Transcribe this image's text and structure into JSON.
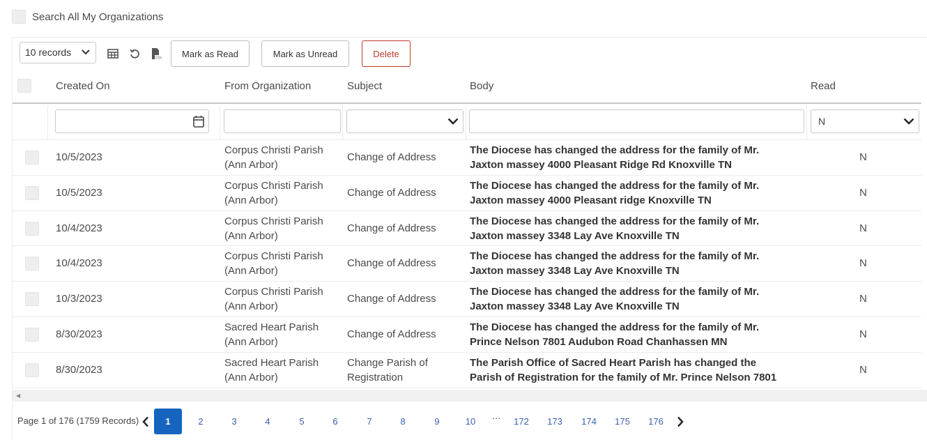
{
  "search_all": {
    "label": "Search All My Organizations"
  },
  "toolbar": {
    "records_value": "10 records",
    "grid_icon": "table-icon",
    "reset_icon": "refresh-icon",
    "csv_icon": "csv-export-icon",
    "mark_read_label": "Mark as Read",
    "mark_unread_label": "Mark as Unread",
    "delete_label": "Delete"
  },
  "columns": {
    "created_on": "Created On",
    "from_org": "From Organization",
    "subject": "Subject",
    "body": "Body",
    "read": "Read"
  },
  "filters": {
    "created_on": "",
    "from_org": "",
    "subject": "",
    "body": "",
    "read": "N"
  },
  "rows": [
    {
      "created": "10/5/2023",
      "org1": "Corpus Christi Parish",
      "org2": "(Ann Arbor)",
      "subj1": "Change of Address",
      "subj2": "",
      "body1": "The Diocese has changed the address for the family of Mr.",
      "body2": "Jaxton massey 4000 Pleasant Ridge Rd Knoxville TN",
      "read": "N"
    },
    {
      "created": "10/5/2023",
      "org1": "Corpus Christi Parish",
      "org2": "(Ann Arbor)",
      "subj1": "Change of Address",
      "subj2": "",
      "body1": "The Diocese has changed the address for the family of Mr.",
      "body2": "Jaxton massey 4000 Pleasant ridge Knoxville TN",
      "read": "N"
    },
    {
      "created": "10/4/2023",
      "org1": "Corpus Christi Parish",
      "org2": "(Ann Arbor)",
      "subj1": "Change of Address",
      "subj2": "",
      "body1": "The Diocese has changed the address for the family of Mr.",
      "body2": "Jaxton massey 3348 Lay Ave Knoxville TN",
      "read": "N"
    },
    {
      "created": "10/4/2023",
      "org1": "Corpus Christi Parish",
      "org2": "(Ann Arbor)",
      "subj1": "Change of Address",
      "subj2": "",
      "body1": "The Diocese has changed the address for the family of Mr.",
      "body2": "Jaxton massey 3348 Lay Ave Knoxville TN",
      "read": "N"
    },
    {
      "created": "10/3/2023",
      "org1": "Corpus Christi Parish",
      "org2": "(Ann Arbor)",
      "subj1": "Change of Address",
      "subj2": "",
      "body1": "The Diocese has changed the address for the family of Mr.",
      "body2": "Jaxton massey 3348 Lay Ave Knoxville TN",
      "read": "N"
    },
    {
      "created": "8/30/2023",
      "org1": "Sacred Heart Parish",
      "org2": "(Ann Arbor)",
      "subj1": "Change of Address",
      "subj2": "",
      "body1": "The Diocese has changed the address for the family of Mr.",
      "body2": "Prince Nelson 7801 Audubon Road Chanhassen MN",
      "read": "N"
    },
    {
      "created": "8/30/2023",
      "org1": "Sacred Heart Parish",
      "org2": "(Ann Arbor)",
      "subj1": "Change Parish of",
      "subj2": "Registration",
      "body1": "The Parish Office of Sacred Heart Parish has changed the",
      "body2": "Parish of Registration for the family of Mr. Prince Nelson 7801",
      "read": "N"
    }
  ],
  "pager": {
    "info": "Page 1 of 176 (1759 Records)",
    "pages": [
      "1",
      "2",
      "3",
      "4",
      "5",
      "6",
      "7",
      "8",
      "9",
      "10",
      "…",
      "172",
      "173",
      "174",
      "175",
      "176"
    ],
    "current": "1",
    "prev_icon": "chevron-left-icon",
    "next_icon": "chevron-right-icon"
  }
}
